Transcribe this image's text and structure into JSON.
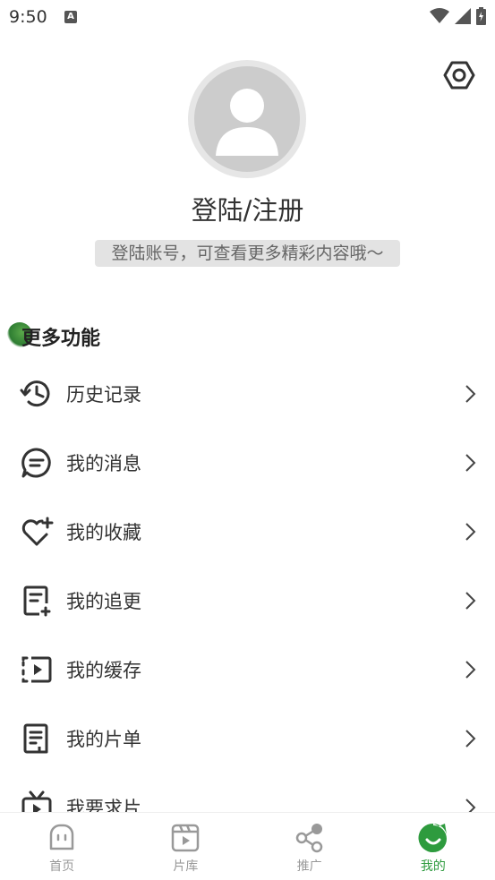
{
  "status_bar": {
    "time": "9:50",
    "notification_letter": "A"
  },
  "profile": {
    "login_title": "登陆/注册",
    "login_hint": "登陆账号，可查看更多精彩内容哦～"
  },
  "section": {
    "title": "更多功能"
  },
  "menu": [
    {
      "label": "历史记录",
      "icon": "history-icon"
    },
    {
      "label": "我的消息",
      "icon": "message-icon"
    },
    {
      "label": "我的收藏",
      "icon": "favorite-heart-icon"
    },
    {
      "label": "我的追更",
      "icon": "follow-updates-icon"
    },
    {
      "label": "我的缓存",
      "icon": "cache-play-icon"
    },
    {
      "label": "我的片单",
      "icon": "playlist-icon"
    },
    {
      "label": "我要求片",
      "icon": "tv-request-icon"
    }
  ],
  "bottom_nav": [
    {
      "label": "首页",
      "icon": "home-icon"
    },
    {
      "label": "片库",
      "icon": "library-icon"
    },
    {
      "label": "推广",
      "icon": "share-icon"
    },
    {
      "label": "我的",
      "icon": "profile-icon"
    }
  ],
  "colors": {
    "accent": "#2e9b3e",
    "icon_stroke": "#333333",
    "inactive": "#999999"
  }
}
